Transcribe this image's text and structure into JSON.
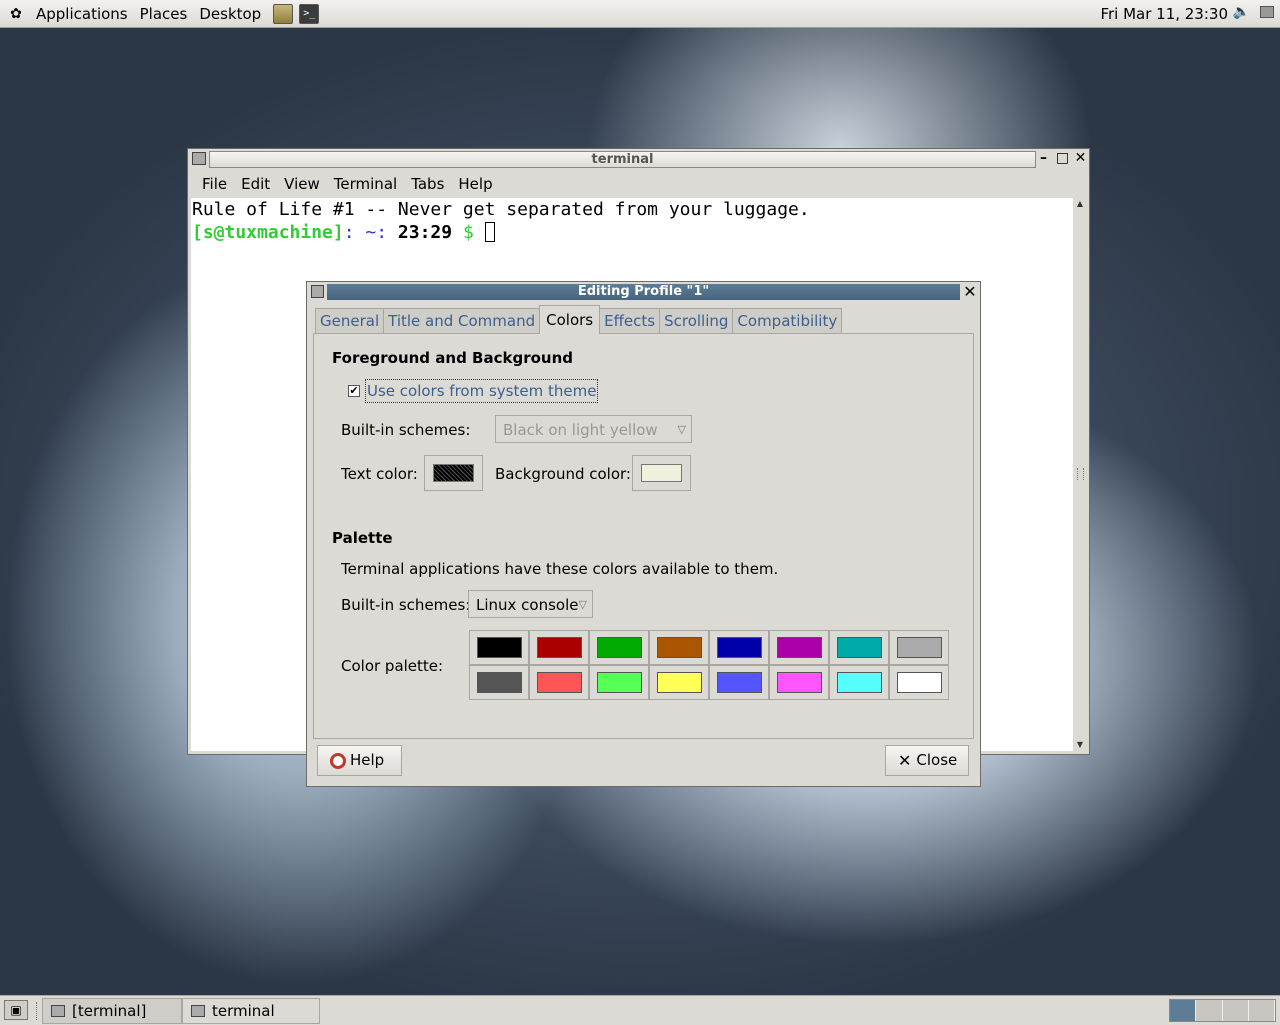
{
  "top_panel": {
    "menus": [
      "Applications",
      "Places",
      "Desktop"
    ],
    "clock": "Fri Mar 11, 23:30"
  },
  "terminal_window": {
    "title": "terminal",
    "menu": [
      "File",
      "Edit",
      "View",
      "Terminal",
      "Tabs",
      "Help"
    ],
    "output_line": "Rule of Life #1 -- Never get separated from your luggage.",
    "prompt": {
      "user_host": "[s@tuxmachine]",
      "path": ": ~:",
      "time": "23:29",
      "symbol": "$"
    }
  },
  "dialog": {
    "title": "Editing Profile \"1\"",
    "tabs": [
      "General",
      "Title and Command",
      "Colors",
      "Effects",
      "Scrolling",
      "Compatibility"
    ],
    "active_tab": "Colors",
    "fg_bg": {
      "heading": "Foreground and Background",
      "use_system_colors_label": "Use colors from system theme",
      "use_system_colors_checked": true,
      "builtin_label": "Built-in schemes:",
      "builtin_value": "Black on light yellow",
      "text_color_label": "Text color:",
      "text_color": "#000000",
      "bg_color_label": "Background color:",
      "bg_color": "#f0f0dc"
    },
    "palette": {
      "heading": "Palette",
      "description": "Terminal applications have these colors available to them.",
      "builtin_label": "Built-in schemes:",
      "builtin_value": "Linux console",
      "palette_label": "Color palette:",
      "colors_row1": [
        "#000000",
        "#aa0000",
        "#00aa00",
        "#aa5500",
        "#0000aa",
        "#aa00aa",
        "#00aaaa",
        "#aaaaaa"
      ],
      "colors_row2": [
        "#555555",
        "#ff5555",
        "#55ff55",
        "#ffff55",
        "#5555ff",
        "#ff55ff",
        "#55ffff",
        "#ffffff"
      ]
    },
    "buttons": {
      "help": "Help",
      "close": "Close"
    }
  },
  "bottom_panel": {
    "tasks": [
      "[terminal]",
      "terminal"
    ]
  }
}
